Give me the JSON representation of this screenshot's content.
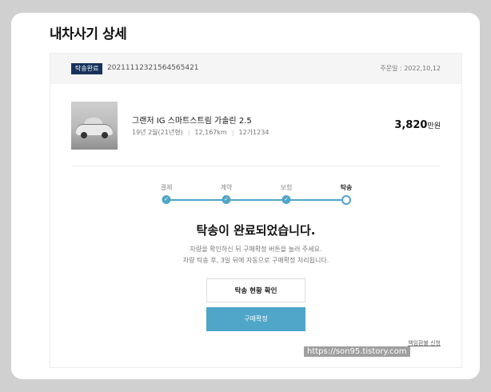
{
  "page": {
    "title": "내차사기 상세"
  },
  "order": {
    "badge": "탁송완료",
    "number": "20211112321564565421",
    "date": "주문일 : 2022,10,12"
  },
  "car": {
    "name": "그랜저 IG 스마트스트림 가솔린 2.5",
    "year": "19년 2월(21년형)",
    "mileage": "12,167km",
    "plate": "12가1234",
    "price_value": "3,820",
    "price_unit": "만원"
  },
  "steps": [
    {
      "label": "결제",
      "state": "done"
    },
    {
      "label": "계약",
      "state": "done"
    },
    {
      "label": "보험",
      "state": "done"
    },
    {
      "label": "탁송",
      "state": "current"
    }
  ],
  "status": {
    "headline": "탁송이 완료되었습니다.",
    "desc_line1": "차량을 확인하신 뒤 구매확정 버튼을 눌러 주세요.",
    "desc_line2": "차량 탁송 후, 3일 뒤에 자동으로 구매확정 처리됩니다."
  },
  "actions": {
    "track_label": "탁송 현황 확인",
    "confirm_label": "구매확정",
    "refund_label": "책임환불 신청"
  },
  "watermark": "https://son95.tistory.com",
  "colors": {
    "accent": "#4fa6c9",
    "badge": "#16325c"
  },
  "icons": {
    "step_done": "check-icon"
  }
}
